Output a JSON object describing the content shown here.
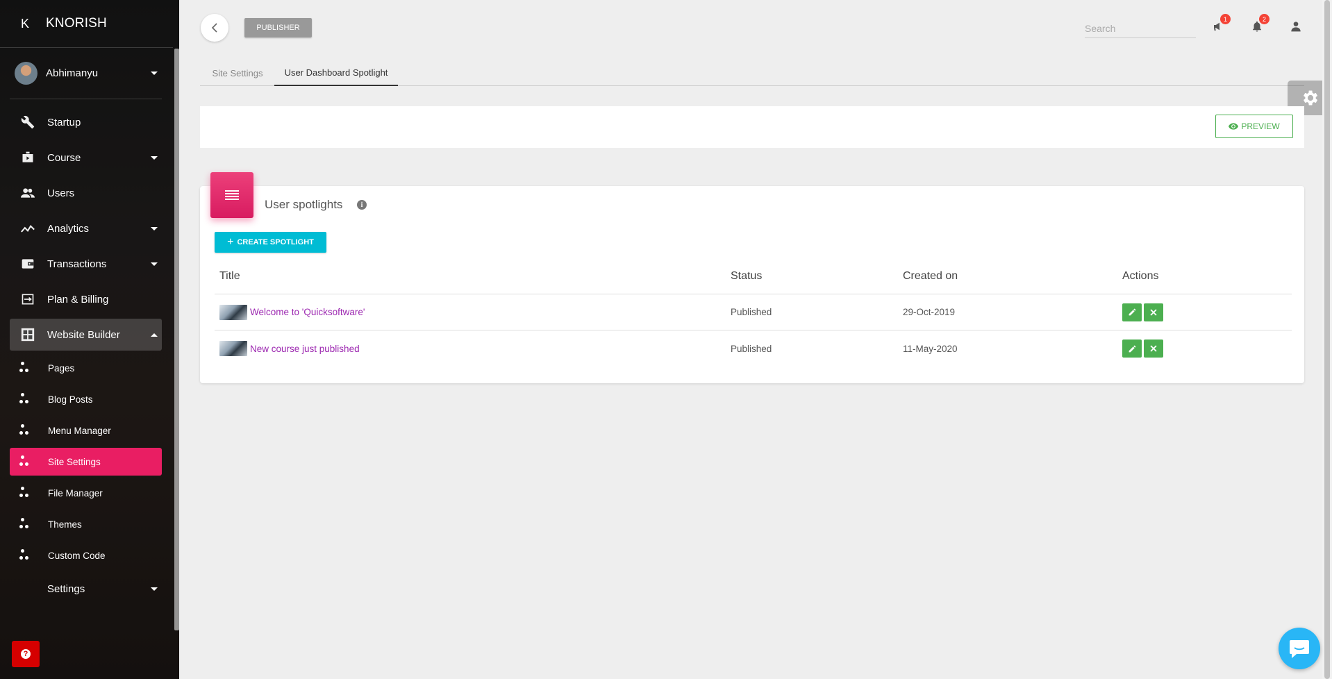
{
  "brand": {
    "initial": "K",
    "name": "KNORISH"
  },
  "user": {
    "name": "Abhimanyu"
  },
  "nav": {
    "startup": "Startup",
    "course": "Course",
    "users": "Users",
    "analytics": "Analytics",
    "transactions": "Transactions",
    "plan_billing": "Plan & Billing",
    "website_builder": "Website Builder",
    "sub": {
      "pages": "Pages",
      "blog_posts": "Blog Posts",
      "menu_manager": "Menu Manager",
      "site_settings": "Site Settings",
      "file_manager": "File Manager",
      "themes": "Themes",
      "custom_code": "Custom Code"
    },
    "settings": "Settings"
  },
  "topbar": {
    "publisher_label": "PUBLISHER",
    "search_placeholder": "Search",
    "announcements_count": "1",
    "notifications_count": "2"
  },
  "tabs": {
    "site_settings": "Site Settings",
    "user_dashboard_spotlight": "User Dashboard Spotlight"
  },
  "preview": {
    "label": "PREVIEW"
  },
  "card": {
    "title": "User spotlights",
    "create_label": "CREATE SPOTLIGHT",
    "columns": {
      "title": "Title",
      "status": "Status",
      "created_on": "Created on",
      "actions": "Actions"
    },
    "rows": [
      {
        "title": "Welcome to 'Quicksoftware'",
        "status": "Published",
        "created_on": "29-Oct-2019"
      },
      {
        "title": "New course just published",
        "status": "Published",
        "created_on": "11-May-2020"
      }
    ]
  },
  "colors": {
    "accent_pink": "#e91e63",
    "cyan": "#00bcd4",
    "green": "#4caf50",
    "link_purple": "#9c27b0"
  }
}
